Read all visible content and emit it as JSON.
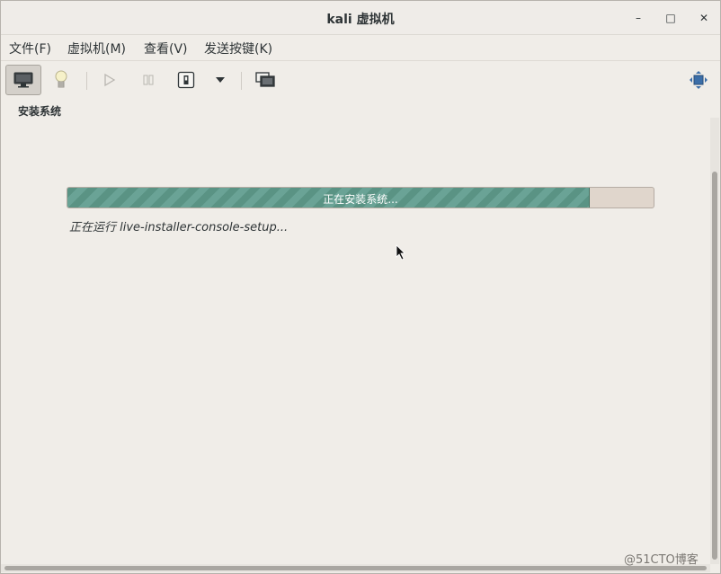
{
  "window": {
    "title": "kali 虚拟机",
    "minimize_glyph": "–",
    "maximize_glyph": "□",
    "close_glyph": "✕"
  },
  "menubar": {
    "items": [
      "文件(F)",
      "虚拟机(M)",
      "查看(V)",
      "发送按键(K)"
    ]
  },
  "toolbar": {
    "icons": [
      "monitor-icon",
      "lightbulb-icon",
      "play-icon",
      "pause-icon",
      "power-icon",
      "dropdown-arrow-icon",
      "snapshot-icon",
      "fullscreen-icon"
    ]
  },
  "section": {
    "label": "安装系统"
  },
  "progress": {
    "text": "正在安装系统...",
    "fraction": 0.89,
    "fill_color": "#5a9384"
  },
  "status": {
    "text": "正在运行 live-installer-console-setup..."
  },
  "watermark": {
    "text": "@51CTO博客"
  }
}
